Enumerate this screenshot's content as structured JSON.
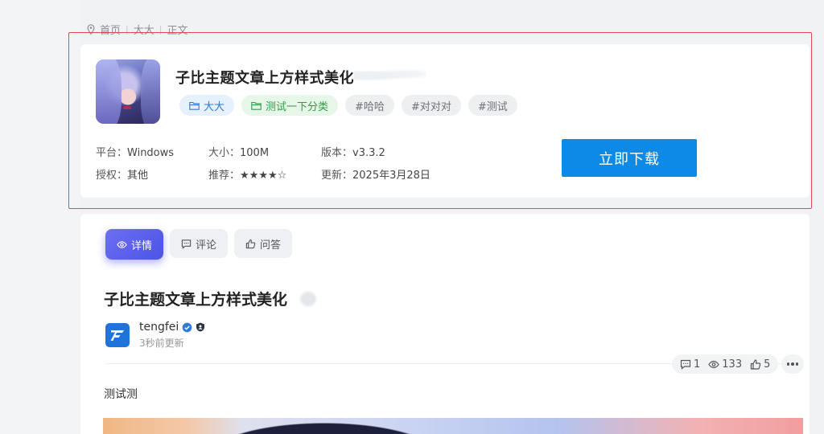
{
  "breadcrumb": {
    "items": [
      "首页",
      "大大",
      "正文"
    ]
  },
  "app": {
    "title": "子比主题文章上方样式美化",
    "tags": [
      {
        "label": "大大",
        "style": "blue",
        "icon": "folder-icon"
      },
      {
        "label": "测试一下分类",
        "style": "green",
        "icon": "folder-icon"
      },
      {
        "label": "#哈哈",
        "style": "gray"
      },
      {
        "label": "#对对对",
        "style": "gray"
      },
      {
        "label": "#测试",
        "style": "gray"
      }
    ],
    "meta": {
      "platform_label": "平台：",
      "platform": "Windows",
      "size_label": "大小：",
      "size": "100M",
      "version_label": "版本：",
      "version": "v3.3.2",
      "license_label": "授权：",
      "license": "其他",
      "rating_label": "推荐：",
      "rating": "★★★★☆",
      "rating_value": 4,
      "rating_max": 5,
      "updated_label": "更新：",
      "updated": "2025年3月28日"
    },
    "download_label": "立即下载",
    "download_color": "#0d8ae6"
  },
  "tabs": [
    {
      "label": "详情",
      "icon": "eye-icon",
      "active": true
    },
    {
      "label": "评论",
      "icon": "comment-icon",
      "active": false
    },
    {
      "label": "问答",
      "icon": "thumbs-up-icon",
      "active": false
    }
  ],
  "post": {
    "title": "子比主题文章上方样式美化",
    "author": "tengfei",
    "time": "3秒前更新",
    "stats": {
      "comments": "1",
      "views": "133",
      "likes": "5"
    },
    "body": "测试测"
  },
  "colors": {
    "accent": "#4d53e6",
    "highlight_border": "#e0494d"
  }
}
